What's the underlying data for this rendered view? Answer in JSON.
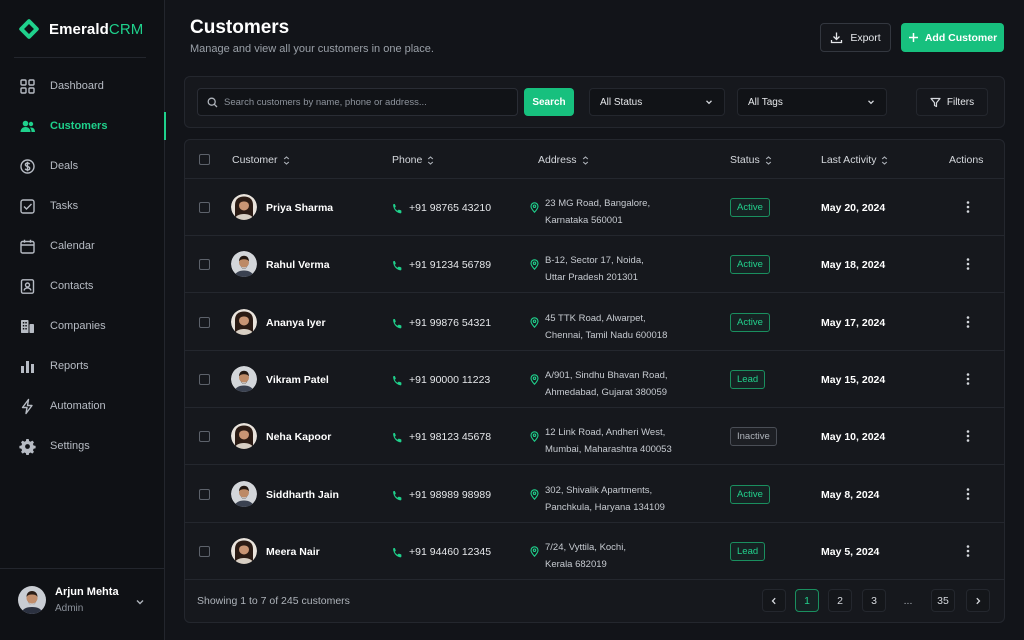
{
  "app": {
    "brand_main": "Emerald",
    "brand_accent": "CRM",
    "accent_color": "#1fd18c"
  },
  "sidebar": {
    "items": [
      {
        "label": "Dashboard",
        "icon": "grid-icon"
      },
      {
        "label": "Customers",
        "icon": "users-icon",
        "active": true
      },
      {
        "label": "Deals",
        "icon": "dollar-icon"
      },
      {
        "label": "Tasks",
        "icon": "checkbox-icon"
      },
      {
        "label": "Calendar",
        "icon": "calendar-icon"
      },
      {
        "label": "Contacts",
        "icon": "contact-card-icon"
      },
      {
        "label": "Companies",
        "icon": "building-icon"
      },
      {
        "label": "Reports",
        "icon": "bar-chart-icon"
      },
      {
        "label": "Automation",
        "icon": "lightning-icon"
      },
      {
        "label": "Settings",
        "icon": "gear-icon"
      }
    ],
    "user": {
      "name": "Arjun Mehta",
      "role": "Admin"
    }
  },
  "header": {
    "title": "Customers",
    "subtitle": "Manage and view all your customers in one place.",
    "export_label": "Export",
    "add_label": "Add Customer"
  },
  "filters": {
    "search_placeholder": "Search customers by name, phone or address...",
    "search_button": "Search",
    "status_value": "All Status",
    "tags_value": "All Tags",
    "filters_label": "Filters"
  },
  "table": {
    "columns": {
      "customer": "Customer",
      "phone": "Phone",
      "address": "Address",
      "status": "Status",
      "activity": "Last Activity",
      "actions": "Actions"
    },
    "rows": [
      {
        "name": "Priya Sharma",
        "phone": "+91 98765 43210",
        "addr1": "23 MG Road, Bangalore,",
        "addr2": "Karnataka 560001",
        "status": "Active",
        "status_kind": "active",
        "activity": "May 20, 2024",
        "avatar": "female"
      },
      {
        "name": "Rahul Verma",
        "phone": "+91 91234 56789",
        "addr1": "B-12, Sector 17, Noida,",
        "addr2": "Uttar Pradesh 201301",
        "status": "Active",
        "status_kind": "active",
        "activity": "May 18, 2024",
        "avatar": "male"
      },
      {
        "name": "Ananya Iyer",
        "phone": "+91 99876 54321",
        "addr1": "45 TTK Road, Alwarpet,",
        "addr2": "Chennai, Tamil Nadu 600018",
        "status": "Active",
        "status_kind": "active",
        "activity": "May 17, 2024",
        "avatar": "female"
      },
      {
        "name": "Vikram Patel",
        "phone": "+91 90000 11223",
        "addr1": "A/901, Sindhu Bhavan Road,",
        "addr2": "Ahmedabad, Gujarat 380059",
        "status": "Lead",
        "status_kind": "lead",
        "activity": "May 15, 2024",
        "avatar": "male"
      },
      {
        "name": "Neha Kapoor",
        "phone": "+91 98123 45678",
        "addr1": "12 Link Road, Andheri West,",
        "addr2": "Mumbai, Maharashtra 400053",
        "status": "Inactive",
        "status_kind": "inactive",
        "activity": "May 10, 2024",
        "avatar": "female"
      },
      {
        "name": "Siddharth Jain",
        "phone": "+91 98989 98989",
        "addr1": "302, Shivalik Apartments,",
        "addr2": "Panchkula, Haryana 134109",
        "status": "Active",
        "status_kind": "active",
        "activity": "May 8, 2024",
        "avatar": "male"
      },
      {
        "name": "Meera Nair",
        "phone": "+91 94460 12345",
        "addr1": "7/24, Vyttila, Kochi,",
        "addr2": "Kerala 682019",
        "status": "Lead",
        "status_kind": "lead",
        "activity": "May 5, 2024",
        "avatar": "female"
      }
    ]
  },
  "footer": {
    "showing": "Showing 1 to 7 of 245 customers",
    "pages": [
      "1",
      "2",
      "3",
      "...",
      "35"
    ],
    "current_page": "1"
  }
}
